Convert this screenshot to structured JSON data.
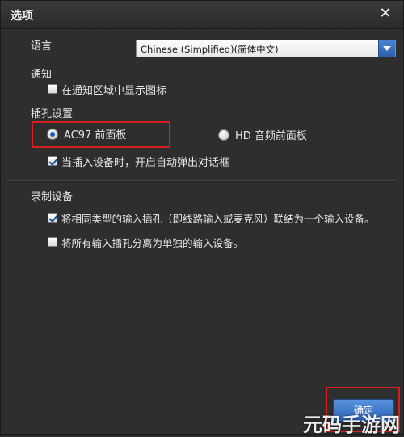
{
  "dialog": {
    "title": "选项",
    "close_icon": "close-icon"
  },
  "language": {
    "label": "语言",
    "selected": "Chinese (Simplified)(简体中文)"
  },
  "notification": {
    "label": "通知",
    "show_tray_icon": {
      "label": "在通知区域中显示图标",
      "checked": false
    }
  },
  "jack_settings": {
    "label": "插孔设置",
    "options": [
      {
        "label": "AC97 前面板",
        "selected": true
      },
      {
        "label": "HD 音频前面板",
        "selected": false
      }
    ],
    "auto_popup": {
      "label": "当插入设备时，开启自动弹出对话框",
      "checked": true
    }
  },
  "recording": {
    "label": "录制设备",
    "link_same_type": {
      "label": "将相同类型的输入插孔（即线路输入或麦克风）联结为一个输入设备。",
      "checked": true
    },
    "separate_all": {
      "label": "将所有输入插孔分离为单独的输入设备。",
      "checked": false
    }
  },
  "footer": {
    "ok_label": "确定"
  },
  "watermark": "元码手游网",
  "colors": {
    "highlight": "#d62020",
    "accent": "#2c63b5",
    "background": "#2e2e2e"
  }
}
